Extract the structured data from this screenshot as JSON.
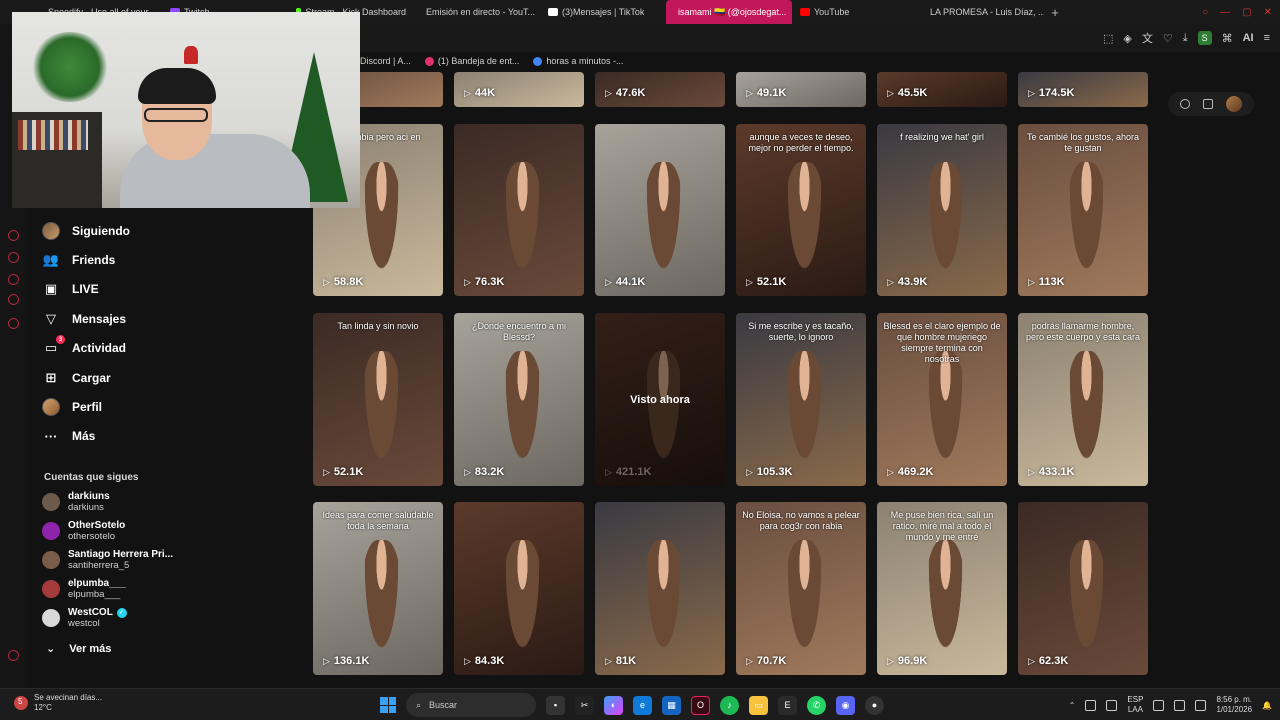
{
  "browser": {
    "tabs": [
      {
        "label": "Speedify - Use all of your...",
        "color": "#1e88e5"
      },
      {
        "label": "Twitch",
        "color": "#9146ff"
      },
      {
        "label": "Stream - Kick Dashboard",
        "color": "#53fc18"
      },
      {
        "label": "Emisión en directo - YouT...",
        "color": "#ff0000"
      },
      {
        "label": "(3)Mensajes | TikTok",
        "color": "#ffffff"
      },
      {
        "label": "isamami 🇨🇴 (@ojosdegat...",
        "color": "#ffffff",
        "active": true
      },
      {
        "label": "YouTube",
        "color": "#ff0000"
      },
      {
        "label": "LA PROMESA - Luis Díaz, ...",
        "color": "#ff0000"
      }
    ],
    "new_tab": "+",
    "bookmarks": [
      {
        "label": "Discord | A...",
        "color": "#5865f2"
      },
      {
        "label": "(1) Bandeja de ent...",
        "color": "#e1306c"
      },
      {
        "label": "horas a minutos -...",
        "color": "#4285f4"
      }
    ],
    "profile_badge": "S",
    "ai_label": "AI"
  },
  "tiktok_nav": {
    "items": [
      {
        "label": "Siguiendo",
        "icon": "following-avatar-icon"
      },
      {
        "label": "Friends",
        "icon": "friends-icon"
      },
      {
        "label": "LIVE",
        "icon": "live-icon"
      },
      {
        "label": "Mensajes",
        "icon": "messages-icon"
      },
      {
        "label": "Actividad",
        "icon": "activity-icon",
        "badge": "3"
      },
      {
        "label": "Cargar",
        "icon": "upload-icon"
      },
      {
        "label": "Perfil",
        "icon": "profile-avatar-icon"
      },
      {
        "label": "Más",
        "icon": "more-icon"
      }
    ],
    "following_title": "Cuentas que sigues",
    "following": [
      {
        "name": "darkiuns",
        "handle": "darkiuns",
        "color": "#6d5a4a"
      },
      {
        "name": "OtherSotelo",
        "handle": "othersotelo",
        "color": "#8e24aa"
      },
      {
        "name": "Santiago Herrera Pri...",
        "handle": "santiherrera_5",
        "color": "#7a5c48"
      },
      {
        "name": "elpumba___",
        "handle": "elpumba___",
        "color": "#a33b3b"
      },
      {
        "name": "WestCOL",
        "handle": "westcol",
        "color": "#d8d8d8",
        "verified": true
      }
    ],
    "see_more": "Ver más"
  },
  "videos": {
    "row0": [
      {
        "views": "",
        "caption": ""
      },
      {
        "views": "44K",
        "caption": ""
      },
      {
        "views": "47.6K",
        "caption": ""
      },
      {
        "views": "49.1K",
        "caption": ""
      },
      {
        "views": "45.5K",
        "caption": ""
      },
      {
        "views": "174.5K",
        "caption": ""
      }
    ],
    "row1": [
      {
        "views": "58.8K",
        "caption": "Colombia pero aci en"
      },
      {
        "views": "76.3K",
        "caption": ""
      },
      {
        "views": "44.1K",
        "caption": ""
      },
      {
        "views": "52.1K",
        "caption": "aunque a veces te deseo, mejor no perder el tiempo."
      },
      {
        "views": "43.9K",
        "caption": "f realizing we hat' girl"
      },
      {
        "views": "113K",
        "caption": "Te cambié los gustos, ahora te gustan"
      }
    ],
    "row2": [
      {
        "views": "52.1K",
        "caption": "Tan linda y sin novio"
      },
      {
        "views": "83.2K",
        "caption": "¿Donde encuentro a mi Blessd?"
      },
      {
        "views": "421.1K",
        "caption": "",
        "watched": "Visto ahora"
      },
      {
        "views": "105.3K",
        "caption": "Si me escribe y es tacaño, suerte, lo ignoro"
      },
      {
        "views": "469.2K",
        "caption": "Blessd es el claro ejemplo de que hombre mujeriego siempre termina con nosotras"
      },
      {
        "views": "433.1K",
        "caption": "podrás llamarme hombre, pero este cuerpo y esta cara"
      }
    ],
    "row3": [
      {
        "views": "136.1K",
        "caption": "Ideas para comer saludable toda la semana"
      },
      {
        "views": "84.3K",
        "caption": ""
      },
      {
        "views": "81K",
        "caption": ""
      },
      {
        "views": "70.7K",
        "caption": "No Eloisa, no vamos a pelear para cog3r con rabia"
      },
      {
        "views": "96.9K",
        "caption": "Me puse bien rica, salí un ratico, miré mal a todo el mundo y me entré"
      },
      {
        "views": "62.3K",
        "caption": ""
      }
    ]
  },
  "taskbar": {
    "weather_text": "Se avecinan días...",
    "temperature": "12°C",
    "weather_badge": "5",
    "search_placeholder": "Buscar",
    "lang": "ESP",
    "lang_sub": "LAA",
    "time": "8:56 p. m.",
    "date": "1/01/2026"
  }
}
